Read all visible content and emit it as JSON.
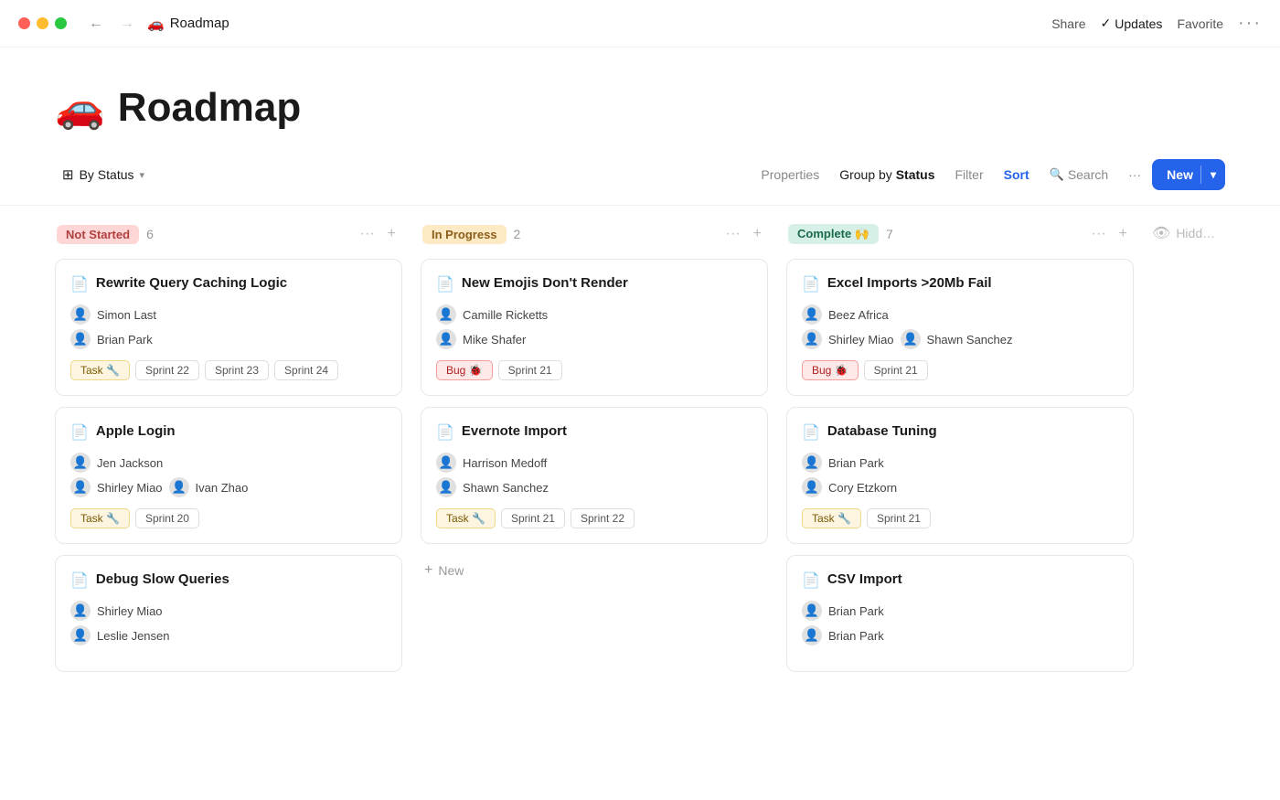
{
  "titlebar": {
    "page_icon": "🚗",
    "page_name": "Roadmap",
    "share_label": "Share",
    "updates_label": "Updates",
    "favorite_label": "Favorite"
  },
  "toolbar": {
    "view_label": "By Status",
    "properties_label": "Properties",
    "group_by_prefix": "Group by",
    "group_by_value": "Status",
    "filter_label": "Filter",
    "sort_label": "Sort",
    "search_label": "Search",
    "more_label": "···",
    "new_label": "New"
  },
  "columns": [
    {
      "id": "not-started",
      "status_label": "Not Started",
      "status_class": "status-not-started",
      "count": 6,
      "cards": [
        {
          "title": "Rewrite Query Caching Logic",
          "people": [
            {
              "name": "Simon Last",
              "avatar": "👤"
            },
            {
              "name": "Brian Park",
              "avatar": "👤"
            }
          ],
          "tags": [
            {
              "label": "Task 🔧",
              "type": "task"
            }
          ],
          "sprints": [
            "Sprint 22",
            "Sprint 23",
            "Sprint 24"
          ]
        },
        {
          "title": "Apple Login",
          "people": [
            {
              "name": "Jen Jackson",
              "avatar": "👤"
            },
            {
              "name": "Shirley Miao",
              "avatar": "👤",
              "extra": "Ivan Zhao",
              "extra_avatar": "👤"
            }
          ],
          "tags": [
            {
              "label": "Task 🔧",
              "type": "task"
            }
          ],
          "sprints": [
            "Sprint 20"
          ]
        },
        {
          "title": "Debug Slow Queries",
          "people": [
            {
              "name": "Shirley Miao",
              "avatar": "👤"
            },
            {
              "name": "Leslie Jensen",
              "avatar": "👤"
            }
          ],
          "tags": [],
          "sprints": []
        }
      ]
    },
    {
      "id": "in-progress",
      "status_label": "In Progress",
      "status_class": "status-in-progress",
      "count": 2,
      "cards": [
        {
          "title": "New Emojis Don't Render",
          "people": [
            {
              "name": "Camille Ricketts",
              "avatar": "👤"
            },
            {
              "name": "Mike Shafer",
              "avatar": "👤"
            }
          ],
          "tags": [
            {
              "label": "Bug 🐞",
              "type": "bug"
            }
          ],
          "sprints": [
            "Sprint 21"
          ]
        },
        {
          "title": "Evernote Import",
          "people": [
            {
              "name": "Harrison Medoff",
              "avatar": "👤"
            },
            {
              "name": "Shawn Sanchez",
              "avatar": "👤"
            }
          ],
          "tags": [
            {
              "label": "Task 🔧",
              "type": "task"
            }
          ],
          "sprints": [
            "Sprint 21",
            "Sprint 22"
          ]
        }
      ],
      "new_label": "New"
    },
    {
      "id": "complete",
      "status_label": "Complete 🙌",
      "status_class": "status-complete",
      "count": 7,
      "cards": [
        {
          "title": "Excel Imports >20Mb Fail",
          "people": [
            {
              "name": "Beez Africa",
              "avatar": "👤"
            },
            {
              "name": "Shirley Miao",
              "avatar": "👤",
              "extra": "Shawn Sanchez",
              "extra_avatar": "👤"
            }
          ],
          "tags": [
            {
              "label": "Bug 🐞",
              "type": "bug"
            }
          ],
          "sprints": [
            "Sprint 21"
          ]
        },
        {
          "title": "Database Tuning",
          "people": [
            {
              "name": "Brian Park",
              "avatar": "👤"
            },
            {
              "name": "Cory Etzkorn",
              "avatar": "👤"
            }
          ],
          "tags": [
            {
              "label": "Task 🔧",
              "type": "task"
            }
          ],
          "sprints": [
            "Sprint 21"
          ]
        },
        {
          "title": "CSV Import",
          "people": [
            {
              "name": "Brian Park",
              "avatar": "👤"
            },
            {
              "name": "Brian Park",
              "avatar": "👤"
            }
          ],
          "tags": [],
          "sprints": []
        }
      ]
    }
  ],
  "hidden_label": "Hidd…"
}
